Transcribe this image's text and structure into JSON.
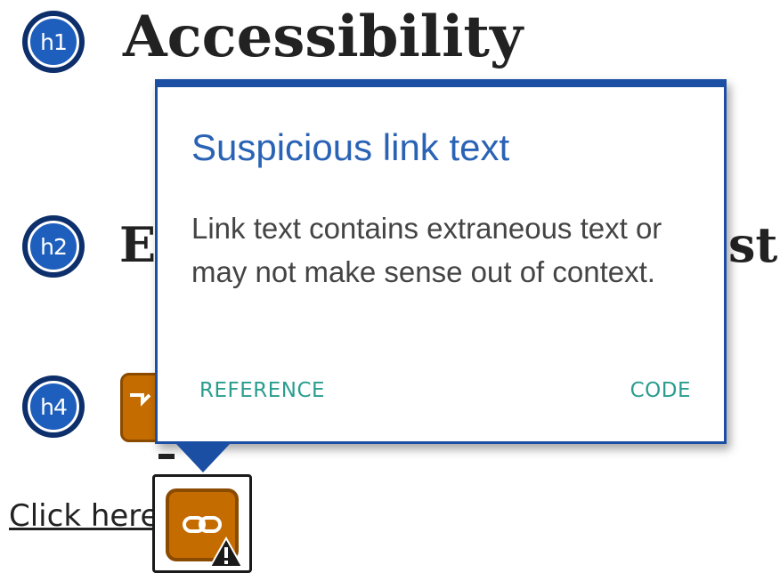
{
  "headings": {
    "h1": {
      "badge": "h1",
      "text": "Accessibility"
    },
    "h2": {
      "badge": "h2",
      "text_start": "E",
      "text_end": "st)"
    },
    "h4": {
      "badge": "h4",
      "text_partial": ""
    }
  },
  "content": {
    "link_text": "Click here"
  },
  "popup": {
    "title": "Suspicious link text",
    "message": "Link text contains extraneous text or may not make sense out of context.",
    "reference_label": "REFERENCE",
    "code_label": "CODE"
  },
  "icons": {
    "link_badge": "link-icon",
    "warning": "warning-icon",
    "h4_issue": "issue-icon"
  },
  "colors": {
    "badge_dark": "#0d2f6b",
    "badge_blue": "#1e5fbd",
    "popup_border": "#1b4fa3",
    "popup_title": "#2a63b5",
    "action_link": "#2a9d8f",
    "issue_orange": "#c46c00"
  }
}
